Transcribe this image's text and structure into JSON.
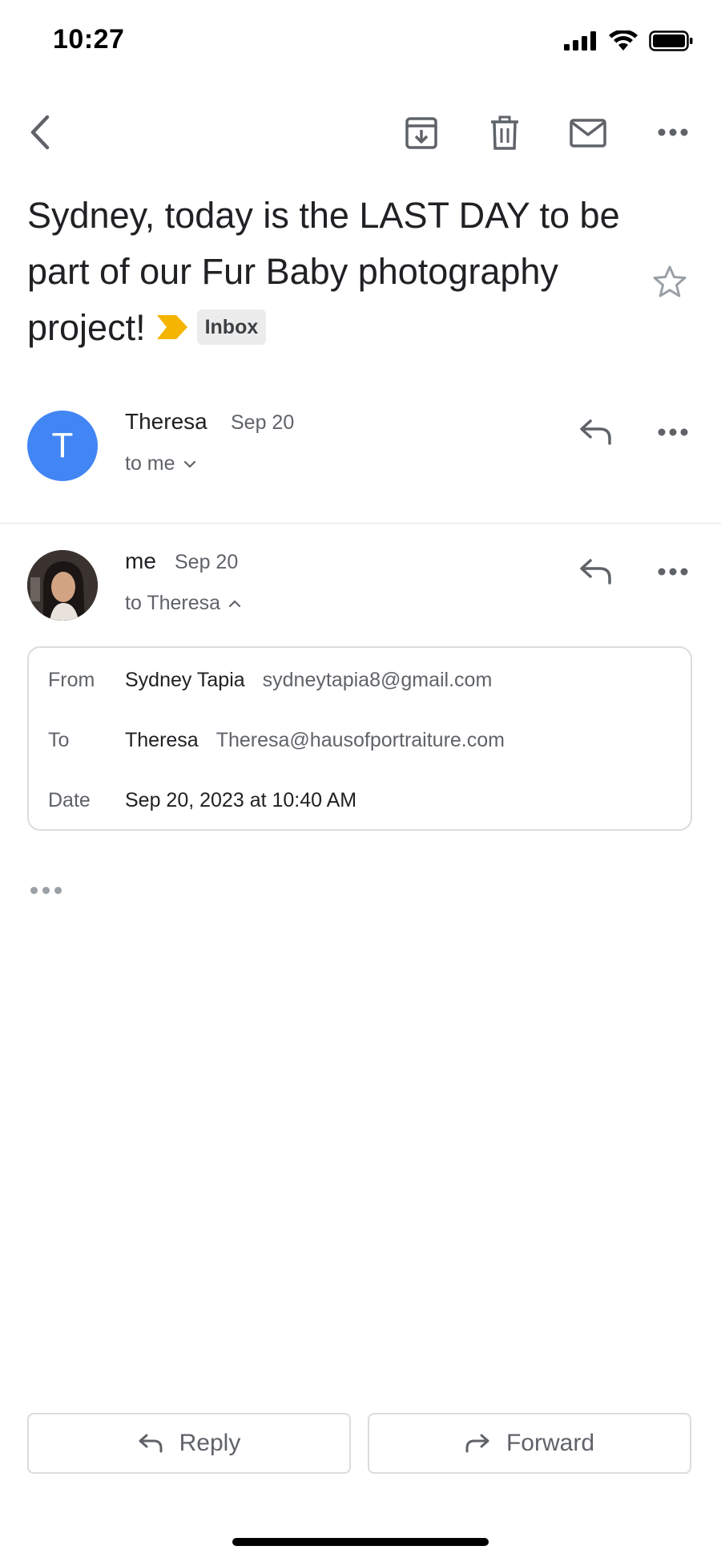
{
  "status_bar": {
    "time": "10:27"
  },
  "toolbar": {
    "back_icon": "chevron-left-icon",
    "archive_icon": "archive-icon",
    "delete_icon": "trash-icon",
    "mark_unread_icon": "mail-icon",
    "more_icon": "more-horizontal-icon"
  },
  "subject": {
    "text": "Sydney, today is the LAST DAY to be part of our Fur Baby photography project!",
    "label_chip": "Inbox",
    "importance_color": "#f4b400"
  },
  "messages": [
    {
      "sender": "Theresa",
      "date": "Sep 20",
      "to_line": "to me",
      "avatar_letter": "T",
      "avatar_color": "#4285f4"
    },
    {
      "sender": "me",
      "date": "Sep 20",
      "to_line": "to Theresa",
      "details": {
        "from_label": "From",
        "from_name": "Sydney Tapia",
        "from_email": "sydneytapia8@gmail.com",
        "to_label": "To",
        "to_name": "Theresa",
        "to_email": "Theresa@hausofportraiture.com",
        "date_label": "Date",
        "date_value": "Sep 20, 2023 at 10:40 AM"
      }
    }
  ],
  "bottom_actions": {
    "reply": "Reply",
    "forward": "Forward"
  }
}
